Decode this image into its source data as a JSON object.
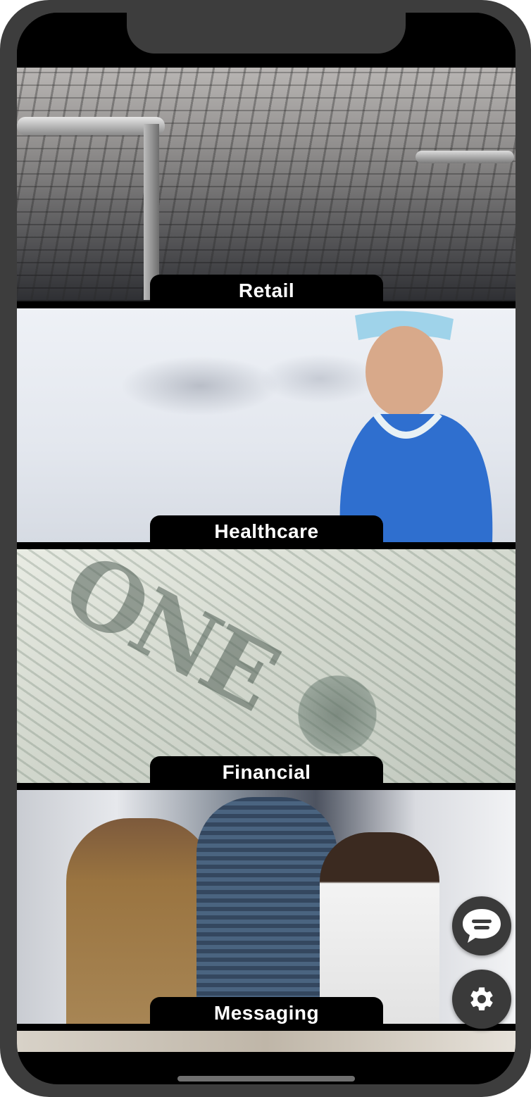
{
  "tiles": [
    {
      "label": "Retail"
    },
    {
      "label": "Healthcare"
    },
    {
      "label": "Financial"
    },
    {
      "label": "Messaging"
    }
  ],
  "fabs": {
    "chat_icon": "chat-bubble-icon",
    "settings_icon": "gear-icon"
  },
  "colors": {
    "frame": "#3d3d3d",
    "label_bg": "#000000",
    "label_text": "#ffffff",
    "fab_bg": "#3a3a3a"
  }
}
